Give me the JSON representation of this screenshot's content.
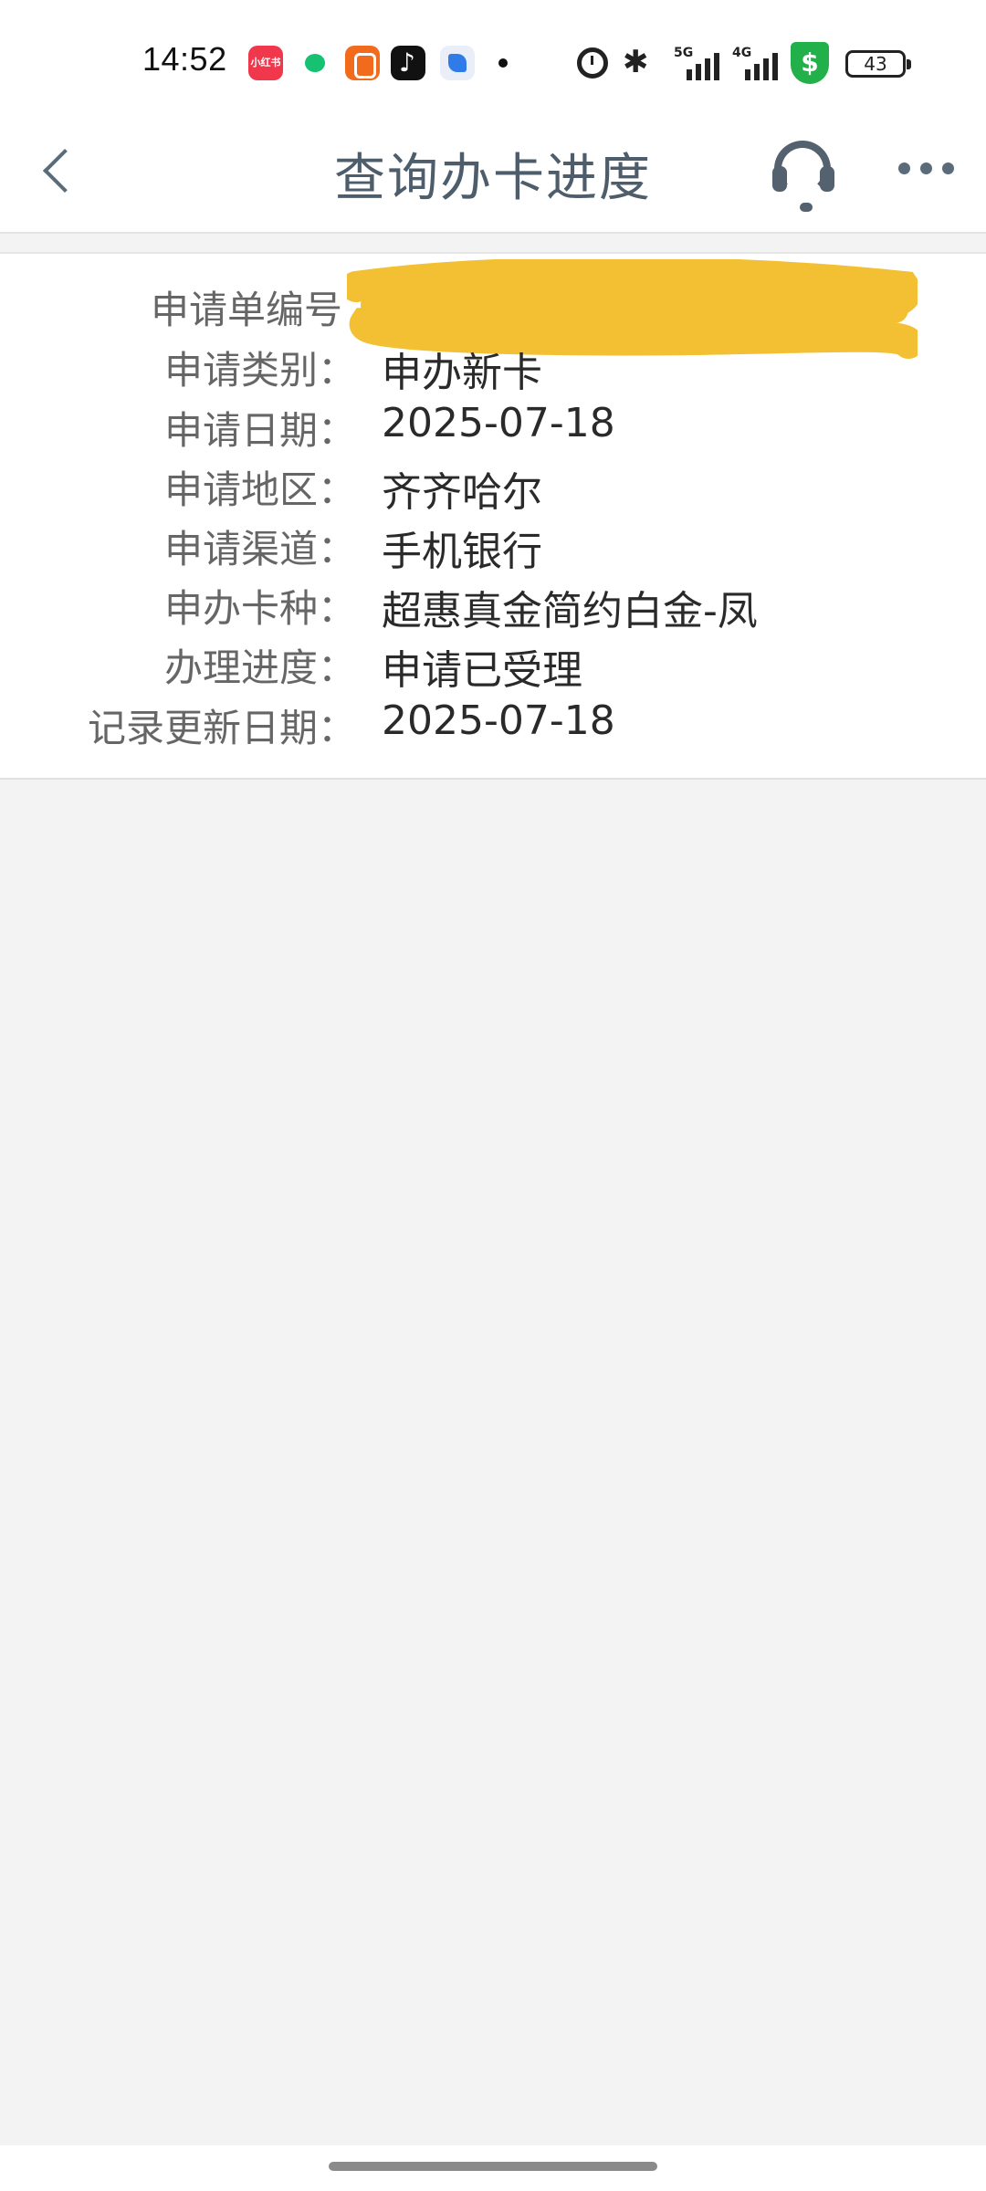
{
  "status_bar": {
    "time": "14:52",
    "notification_icons": [
      "xiaohongshu-icon",
      "message-icon",
      "kuaishou-icon",
      "tiktok-icon",
      "feather-icon"
    ],
    "app_label_1": "小红书",
    "signal_1_tag": "5G",
    "signal_2_tag": "4G",
    "battery": "43",
    "shield_symbol": "$"
  },
  "header": {
    "title": "查询办卡进度",
    "back_icon": "chevron-left-icon",
    "service_icon": "headset-icon",
    "more_icon": "more-icon"
  },
  "application": {
    "rows": [
      {
        "label": "申请单编号",
        "value": ""
      },
      {
        "label": "申请类别：",
        "value": "申办新卡"
      },
      {
        "label": "申请日期：",
        "value": "2025-07-18"
      },
      {
        "label": "申请地区：",
        "value": "齐齐哈尔"
      },
      {
        "label": "申请渠道：",
        "value": "手机银行"
      },
      {
        "label": "申办卡种：",
        "value": "超惠真金简约白金-凤"
      },
      {
        "label": "办理进度：",
        "value": "申请已受理"
      },
      {
        "label": "记录更新日期：",
        "value": "2025-07-18"
      }
    ]
  },
  "colors": {
    "background": "#f3f3f3",
    "redaction": "#f2c032",
    "title": "#4e5d6c"
  }
}
